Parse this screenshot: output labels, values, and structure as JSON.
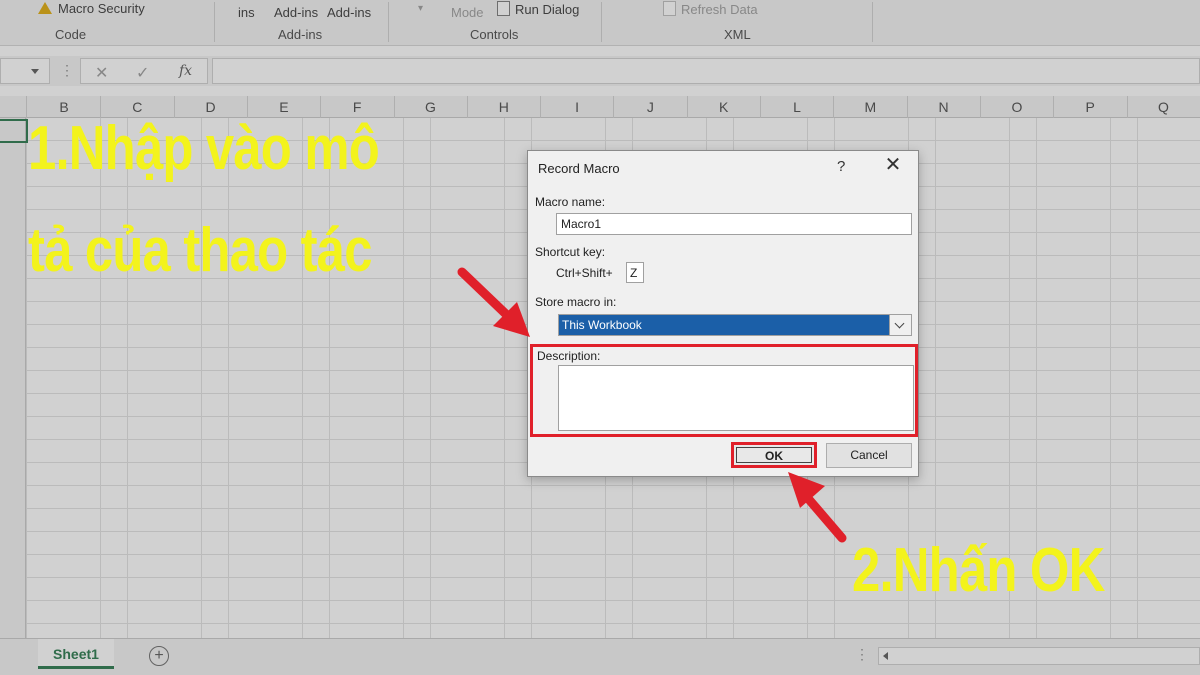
{
  "ribbon": {
    "macro_security": "Macro Security",
    "group_code": "Code",
    "ins": "ins",
    "addins_1": "Add-ins",
    "addins_2": "Add-ins",
    "group_addins": "Add-ins",
    "mode": "Mode",
    "run_dialog": "Run Dialog",
    "group_controls": "Controls",
    "refresh_data": "Refresh Data",
    "group_xml": "XML"
  },
  "formula_bar": {
    "cancel_icon": "close-icon",
    "enter_icon": "check-icon",
    "fx_label": "fx"
  },
  "columns": [
    "B",
    "C",
    "D",
    "E",
    "F",
    "G",
    "H",
    "I",
    "J",
    "K",
    "L",
    "M",
    "N",
    "O",
    "P",
    "Q"
  ],
  "dialog": {
    "title": "Record Macro",
    "help": "?",
    "close": "✕",
    "macro_name_label": "Macro name:",
    "macro_name_value": "Macro1",
    "shortcut_label": "Shortcut key:",
    "shortcut_prefix": "Ctrl+Shift+",
    "shortcut_value": "Z",
    "store_label": "Store macro in:",
    "store_value": "This Workbook",
    "description_label": "Description:",
    "description_value": "",
    "ok": "OK",
    "cancel": "Cancel"
  },
  "sheets": {
    "tab": "Sheet1",
    "add": "+"
  },
  "annotations": {
    "step1_line1": "1.Nhập vào mô",
    "step1_line2": "tả của thao tác",
    "step2": "2.Nhấn OK"
  },
  "colors": {
    "annotation": "#f3f31c",
    "highlight": "#e0202a",
    "selection": "#1b5fa8",
    "excel_green": "#217346"
  }
}
